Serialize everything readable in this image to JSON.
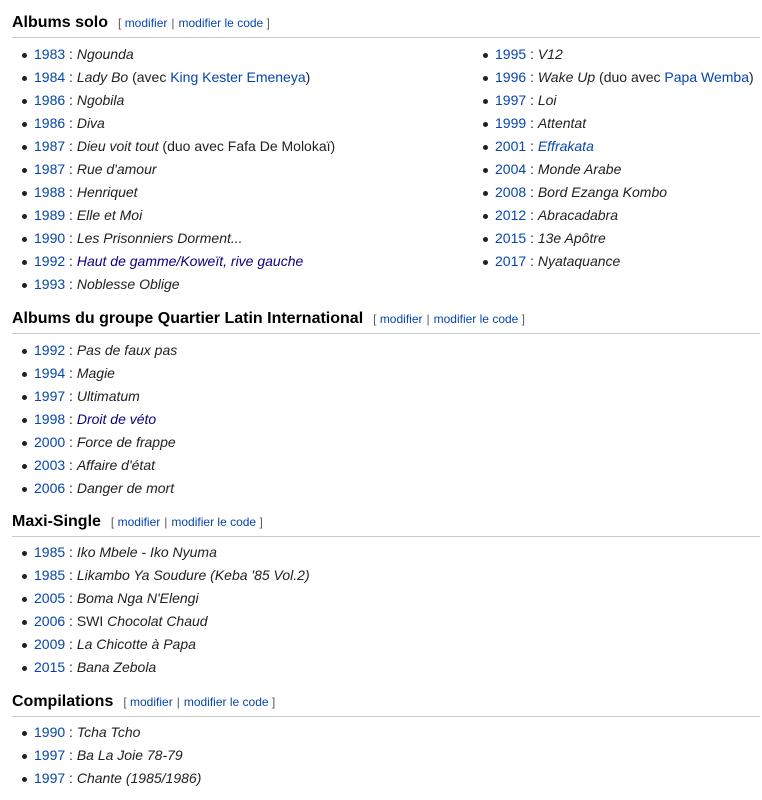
{
  "sections": [
    {
      "title": "Albums solo",
      "edit": {
        "label": "modifier",
        "code": "modifier le code"
      },
      "columns": [
        [
          {
            "year": "1983",
            "title": "Ngounda"
          },
          {
            "year": "1984",
            "title": "Lady Bo",
            "paren_prefix": " (avec ",
            "paren_link": "King Kester Emeneya",
            "paren_suffix": ")"
          },
          {
            "year": "1986",
            "title": "Ngobila"
          },
          {
            "year": "1986",
            "title": "Diva"
          },
          {
            "year": "1987",
            "title": "Dieu voit tout",
            "paren_prefix": " (duo avec Fafa De Molokaï)"
          },
          {
            "year": "1987",
            "title": "Rue d'amour"
          },
          {
            "year": "1988",
            "title": "Henriquet"
          },
          {
            "year": "1989",
            "title": "Elle et Moi"
          },
          {
            "year": "1990",
            "title": "Les Prisonniers Dorment..."
          },
          {
            "year": "1992",
            "title": "Haut de gamme/Koweït, rive gauche",
            "title_style": "visited"
          },
          {
            "year": "1993",
            "title": "Noblesse Oblige"
          }
        ],
        [
          {
            "year": "1995",
            "title": "V12"
          },
          {
            "year": "1996",
            "title": "Wake Up",
            "paren_prefix": " (duo avec ",
            "paren_link": "Papa Wemba",
            "paren_suffix": ")"
          },
          {
            "year": "1997",
            "title": "Loi"
          },
          {
            "year": "1999",
            "title": "Attentat"
          },
          {
            "year": "2001",
            "title": "Effrakata",
            "title_style": "link"
          },
          {
            "year": "2004",
            "title": "Monde Arabe"
          },
          {
            "year": "2008",
            "title": "Bord Ezanga Kombo"
          },
          {
            "year": "2012",
            "title": "Abracadabra"
          },
          {
            "year": "2015",
            "title": "13e Apôtre"
          },
          {
            "year": "2017",
            "title": "Nyataquance"
          }
        ]
      ]
    },
    {
      "title": "Albums du groupe Quartier Latin International",
      "edit": {
        "label": "modifier",
        "code": "modifier le code"
      },
      "columns": [
        [
          {
            "year": "1992",
            "title": "Pas de faux pas"
          },
          {
            "year": "1994",
            "title": "Magie"
          },
          {
            "year": "1997",
            "title": "Ultimatum"
          },
          {
            "year": "1998",
            "title": "Droit de véto",
            "title_style": "visited"
          },
          {
            "year": "2000",
            "title": "Force de frappe"
          },
          {
            "year": "2003",
            "title": "Affaire d'état"
          },
          {
            "year": "2006",
            "title": "Danger de mort"
          }
        ]
      ]
    },
    {
      "title": "Maxi-Single",
      "edit": {
        "label": "modifier",
        "code": "modifier le code"
      },
      "columns": [
        [
          {
            "year": "1985",
            "title": "Iko Mbele - Iko Nyuma"
          },
          {
            "year": "1985",
            "title": "Likambo Ya Soudure (Keba '85 Vol.2)"
          },
          {
            "year": "2005",
            "title": "Boma Nga N'Elengi"
          },
          {
            "year": "2006",
            "plain_prefix": "SWI ",
            "title": "Chocolat Chaud"
          },
          {
            "year": "2009",
            "title": "La Chicotte à Papa"
          },
          {
            "year": "2015",
            "title": "Bana Zebola"
          }
        ]
      ]
    },
    {
      "title": "Compilations",
      "edit": {
        "label": "modifier",
        "code": "modifier le code"
      },
      "columns": [
        [
          {
            "year": "1990",
            "title": "Tcha Tcho"
          },
          {
            "year": "1997",
            "title": "Ba La Joie 78-79"
          },
          {
            "year": "1997",
            "title": "Chante (1985/1986)"
          }
        ]
      ]
    }
  ],
  "colors": {
    "link": "#0645ad",
    "visited": "#0b0080",
    "text": "#202122",
    "divider": "#c8ccd1"
  }
}
